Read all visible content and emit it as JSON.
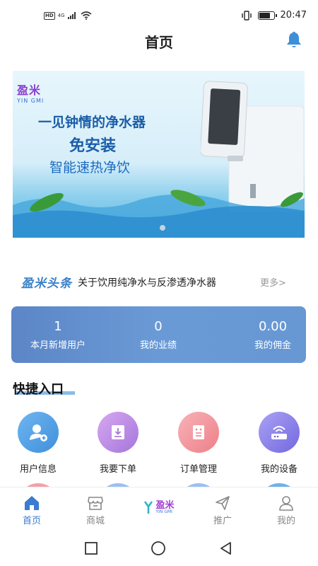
{
  "status_bar": {
    "hd": "HD",
    "network": "4G",
    "time": "20:47"
  },
  "header": {
    "title": "首页"
  },
  "banner": {
    "logo_cn": "盈米",
    "logo_en": "YIN GMI",
    "headline": "一见钟情的净水器",
    "subheadline": "免安装",
    "tagline": "智能速热净饮"
  },
  "news": {
    "logo": "盈米头条",
    "headline": "关于饮用纯净水与反渗透净水器",
    "more": "更多>"
  },
  "stats": [
    {
      "value": "1",
      "label": "本月新增用户"
    },
    {
      "value": "0",
      "label": "我的业绩"
    },
    {
      "value": "0.00",
      "label": "我的佣金"
    }
  ],
  "quick_entry": {
    "title": "快捷入口",
    "items": [
      {
        "label": "用户信息",
        "icon": "user-info-icon"
      },
      {
        "label": "我要下单",
        "icon": "place-order-icon"
      },
      {
        "label": "订单管理",
        "icon": "order-manage-icon"
      },
      {
        "label": "我的设备",
        "icon": "device-icon"
      }
    ]
  },
  "tabbar": {
    "items": [
      {
        "label": "首页",
        "icon": "home-icon",
        "active": true
      },
      {
        "label": "商城",
        "icon": "shop-icon",
        "active": false
      },
      {
        "label": "",
        "icon": "brand-logo-icon",
        "logo_cn": "盈米",
        "logo_en": "YIN GMI",
        "active": false
      },
      {
        "label": "推广",
        "icon": "send-icon",
        "active": false
      },
      {
        "label": "我的",
        "icon": "profile-icon",
        "active": false
      }
    ]
  },
  "colors": {
    "accent": "#3b7bd1",
    "stats_card": "#6a9ad6"
  }
}
